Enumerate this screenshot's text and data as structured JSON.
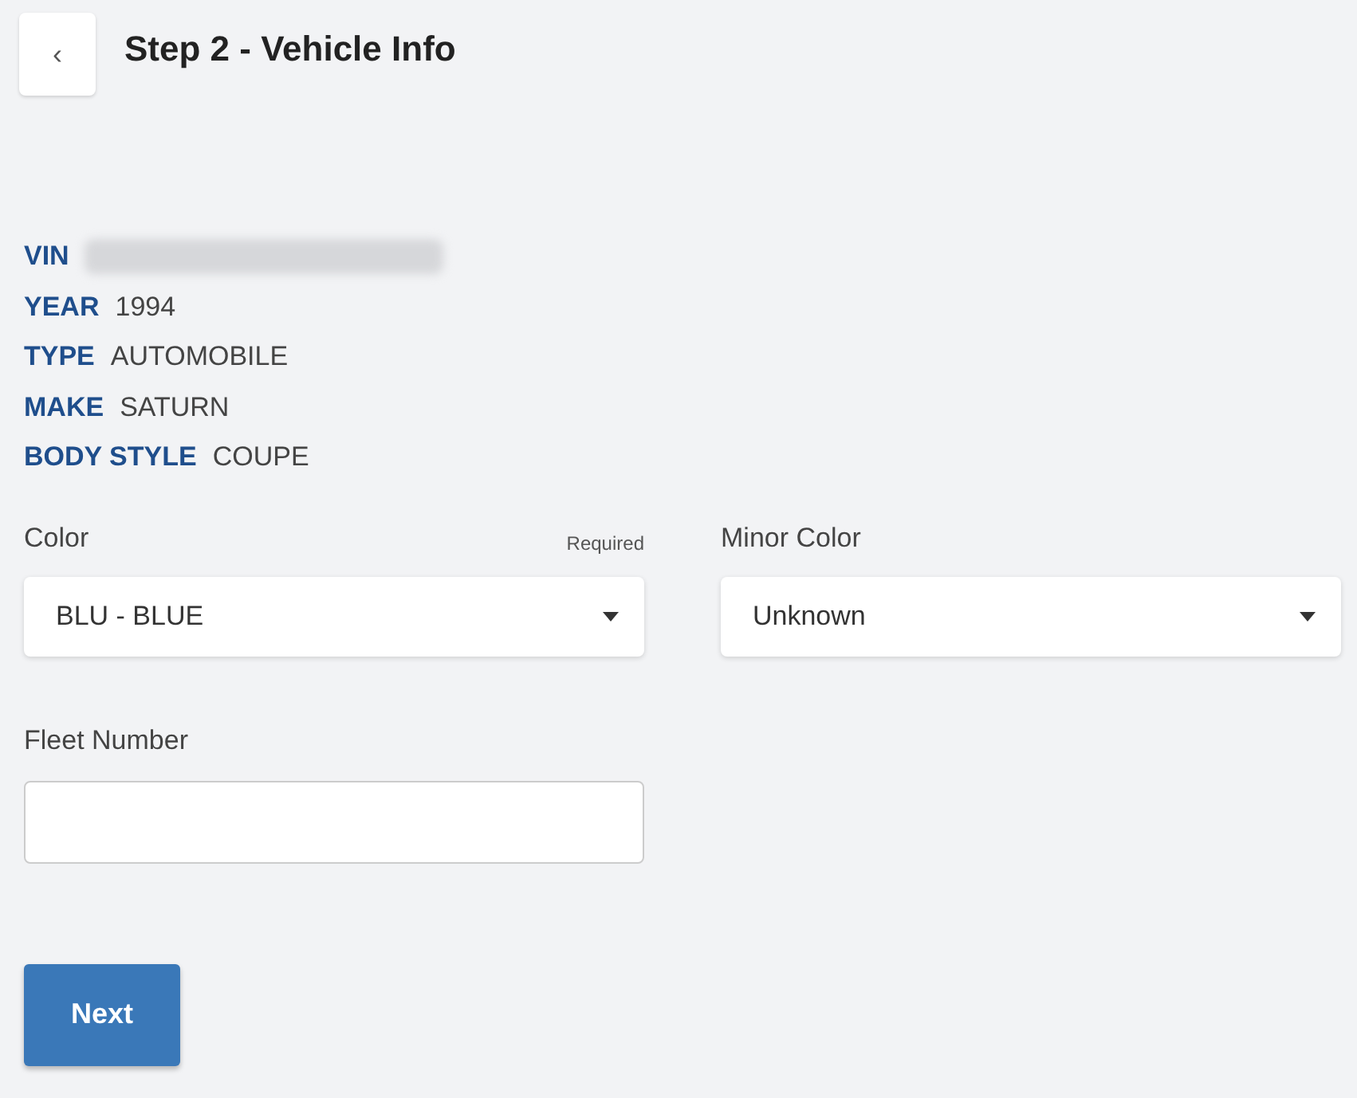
{
  "header": {
    "back": "‹",
    "title": "Step 2 - Vehicle Info"
  },
  "details": [
    {
      "label": "VIN",
      "redacted": true
    },
    {
      "label": "YEAR",
      "redacted": false,
      "value": "1994"
    },
    {
      "label": "TYPE",
      "redacted": false,
      "value": "AUTOMOBILE"
    },
    {
      "label": "MAKE",
      "redacted": false,
      "value": "SATURN"
    },
    {
      "label": "BODY STYLE",
      "redacted": false,
      "value": "COUPE"
    }
  ],
  "selects": [
    {
      "label": "Color",
      "required": "Required",
      "value": "BLU - BLUE"
    },
    {
      "label": "Minor Color",
      "value": "Unknown"
    }
  ],
  "fleet": {
    "label": "Fleet Number"
  },
  "button": "Next"
}
